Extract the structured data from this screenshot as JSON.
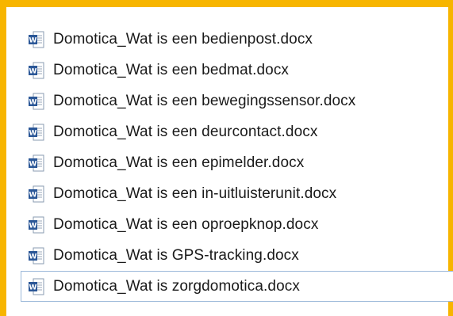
{
  "colors": {
    "frame_highlight": "#f7b500",
    "selection_border": "#9bb8d9",
    "word_icon_blue": "#2b5797"
  },
  "files": [
    {
      "name": "Domotica_Wat is een bedienpost.docx",
      "icon": "word-document-icon",
      "selected": false
    },
    {
      "name": "Domotica_Wat is een bedmat.docx",
      "icon": "word-document-icon",
      "selected": false
    },
    {
      "name": "Domotica_Wat is een bewegingssensor.docx",
      "icon": "word-document-icon",
      "selected": false
    },
    {
      "name": "Domotica_Wat is een deurcontact.docx",
      "icon": "word-document-icon",
      "selected": false
    },
    {
      "name": "Domotica_Wat is een epimelder.docx",
      "icon": "word-document-icon",
      "selected": false
    },
    {
      "name": "Domotica_Wat is een in-uitluisterunit.docx",
      "icon": "word-document-icon",
      "selected": false
    },
    {
      "name": "Domotica_Wat is een oproepknop.docx",
      "icon": "word-document-icon",
      "selected": false
    },
    {
      "name": "Domotica_Wat is GPS-tracking.docx",
      "icon": "word-document-icon",
      "selected": false
    },
    {
      "name": "Domotica_Wat is zorgdomotica.docx",
      "icon": "word-document-icon",
      "selected": true
    }
  ]
}
